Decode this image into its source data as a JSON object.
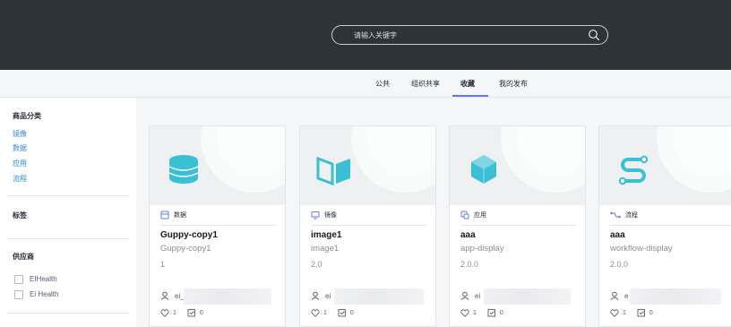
{
  "search": {
    "placeholder": "请输入关键字"
  },
  "tabs": [
    {
      "label": "公共"
    },
    {
      "label": "组织共享"
    },
    {
      "label": "收藏"
    },
    {
      "label": "我的发布"
    }
  ],
  "active_tab": "收藏",
  "sidebar": {
    "category_title": "商品分类",
    "categories": [
      "镜像",
      "数据",
      "应用",
      "流程"
    ],
    "tag_title": "标签",
    "supplier_title": "供应商",
    "suppliers": [
      "EIHealth",
      "Ei Health"
    ]
  },
  "cards": [
    {
      "type_label": "数据",
      "title": "Guppy-copy1",
      "subtitle": "Guppy-copy1",
      "version": "1",
      "owner": "ei_",
      "likes": "1",
      "favorites": "0",
      "icon": "database-icon"
    },
    {
      "type_label": "镜像",
      "title": "image1",
      "subtitle": "image1",
      "version": "2.0",
      "owner": "ei",
      "likes": "1",
      "favorites": "0",
      "icon": "image-icon"
    },
    {
      "type_label": "应用",
      "title": "aaa",
      "subtitle": "app-display",
      "version": "2.0.0",
      "owner": "ei",
      "likes": "1",
      "favorites": "0",
      "icon": "cube-icon"
    },
    {
      "type_label": "流程",
      "title": "aaa",
      "subtitle": "workflow-display",
      "version": "2.0.0",
      "owner": "e",
      "likes": "1",
      "favorites": "0",
      "icon": "workflow-icon"
    }
  ],
  "colors": {
    "header_bg": "#2e3339",
    "accent": "#5e7ce0",
    "link": "#2e89d8",
    "icon_teal": "#3bbfd5"
  }
}
